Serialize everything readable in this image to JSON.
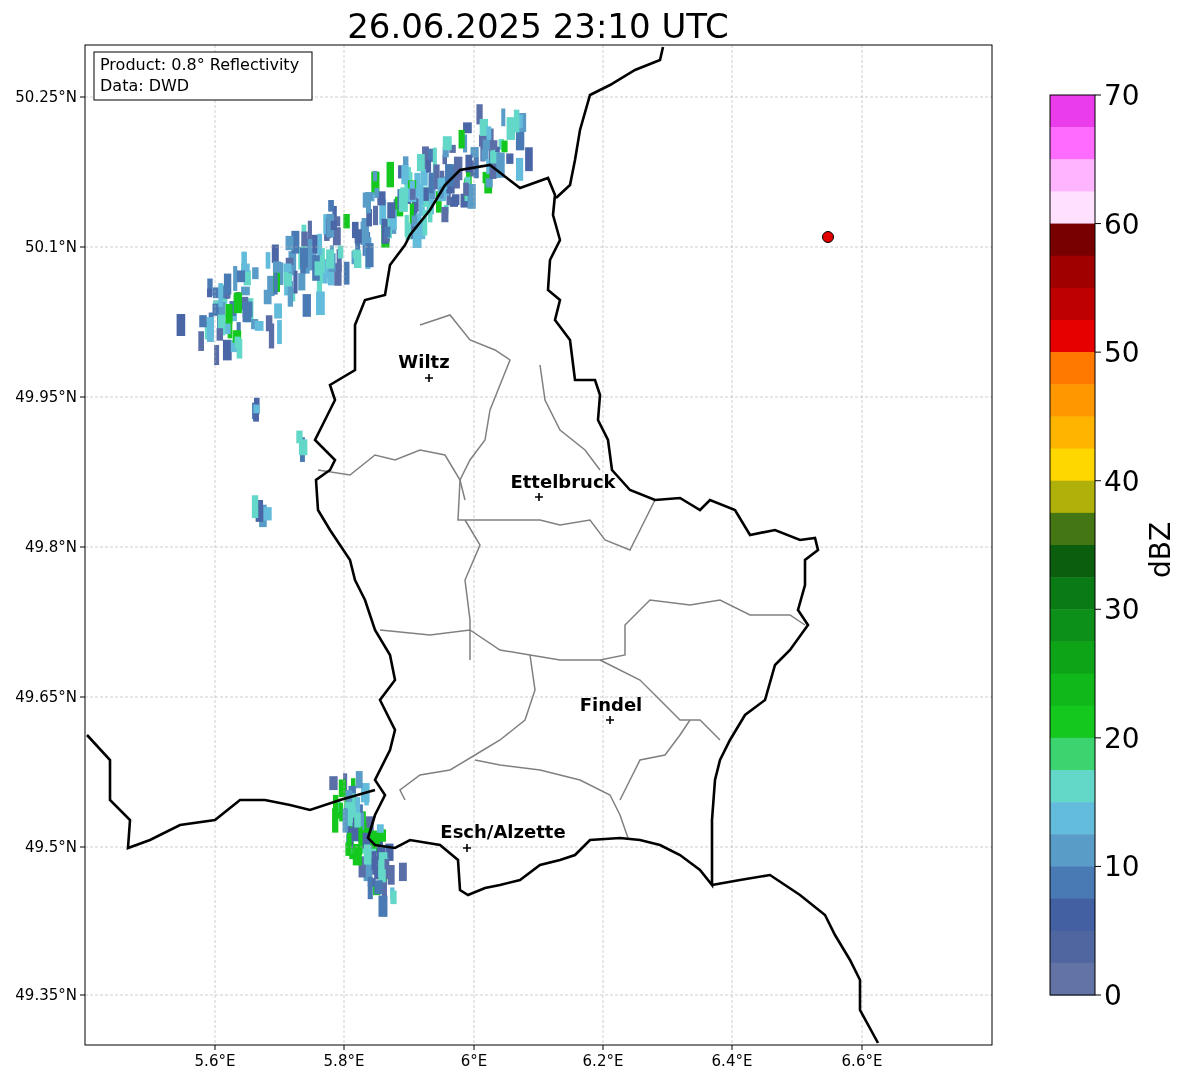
{
  "title": "26.06.2025 23:10 UTC",
  "info_box": {
    "lines": [
      "Product: 0.8° Reflectivity",
      "Data: DWD"
    ]
  },
  "map": {
    "x_ticks": [
      "5.6°E",
      "5.8°E",
      "6°E",
      "6.2°E",
      "6.4°E",
      "6.6°E"
    ],
    "y_ticks": [
      "50.25°N",
      "50.1°N",
      "49.95°N",
      "49.8°N",
      "49.65°N",
      "49.5°N",
      "49.35°N"
    ],
    "places": [
      {
        "name": "Wiltz"
      },
      {
        "name": "Ettelbruck"
      },
      {
        "name": "Findel"
      },
      {
        "name": "Esch/Alzette"
      }
    ]
  },
  "colorbar": {
    "label": "dBZ",
    "ticks": [
      "70",
      "60",
      "50",
      "40",
      "30",
      "20",
      "10",
      "0"
    ],
    "bins": [
      {
        "color": "#eb3ceb"
      },
      {
        "color": "#ff6aff"
      },
      {
        "color": "#ffb4ff"
      },
      {
        "color": "#ffe0ff"
      },
      {
        "color": "#780000"
      },
      {
        "color": "#a00000"
      },
      {
        "color": "#be0000"
      },
      {
        "color": "#e60000"
      },
      {
        "color": "#ff7800"
      },
      {
        "color": "#ff9800"
      },
      {
        "color": "#ffb400"
      },
      {
        "color": "#ffd700"
      },
      {
        "color": "#b0b00a"
      },
      {
        "color": "#457614"
      },
      {
        "color": "#0a5e0e"
      },
      {
        "color": "#0a7a14"
      },
      {
        "color": "#0c901a"
      },
      {
        "color": "#0ea418"
      },
      {
        "color": "#10b81a"
      },
      {
        "color": "#14c81e"
      },
      {
        "color": "#3cd46e"
      },
      {
        "color": "#64d8c8"
      },
      {
        "color": "#64bcdc"
      },
      {
        "color": "#5a9cc8"
      },
      {
        "color": "#4a7ab4"
      },
      {
        "color": "#4360a3"
      },
      {
        "color": "#5066a0"
      },
      {
        "color": "#6473a5"
      }
    ]
  }
}
